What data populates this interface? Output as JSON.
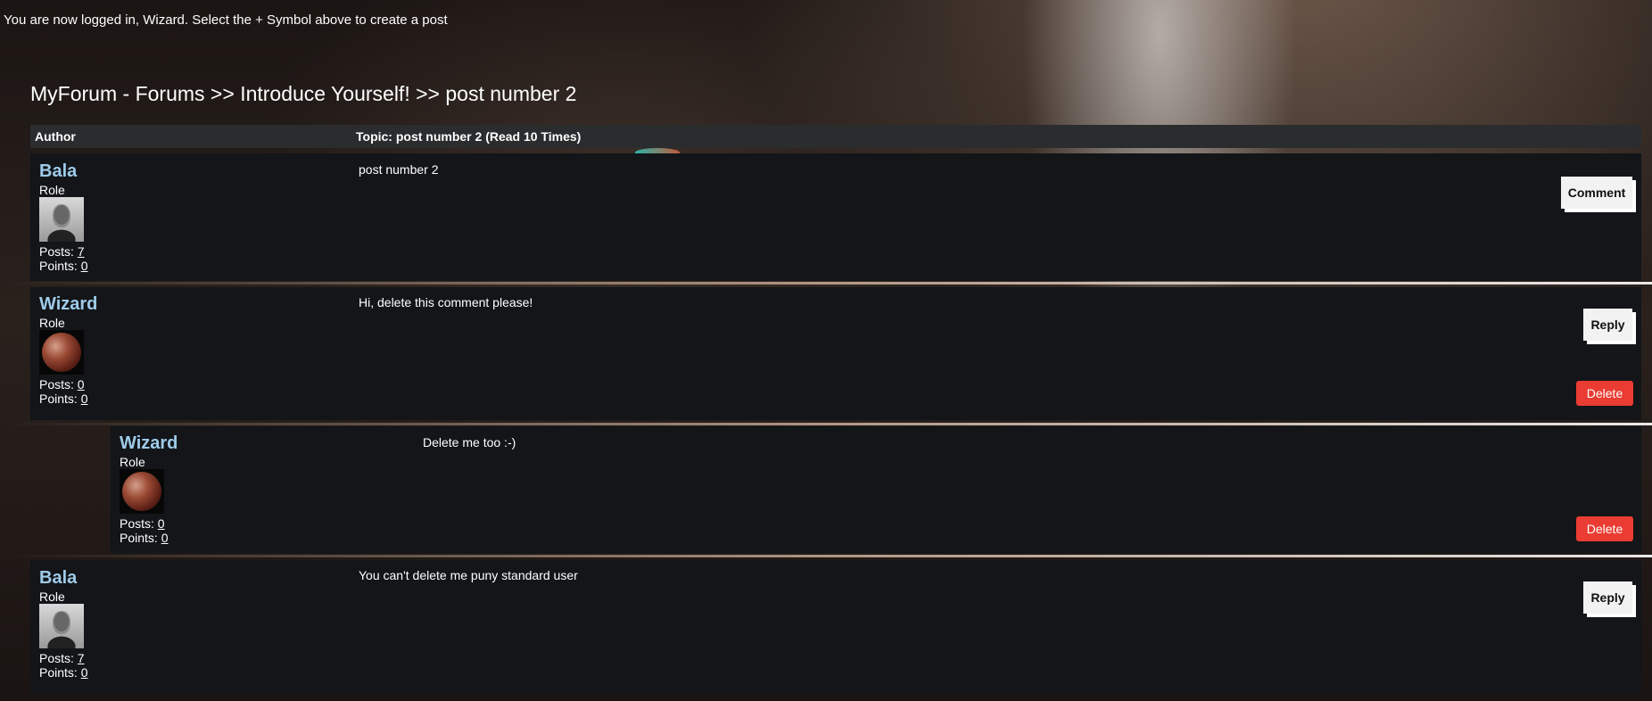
{
  "status": {
    "login_message": "You are now logged in, Wizard. Select the + Symbol above to create a post"
  },
  "breadcrumb": {
    "site": "MyForum",
    "separator1": " - ",
    "forums": "Forums",
    "separator2": " >> ",
    "category": "Introduce Yourself!",
    "separator3": " >> ",
    "topic": "post number 2"
  },
  "table_header": {
    "author": "Author",
    "topic": "Topic: post number 2 (Read 10 Times)"
  },
  "posts": [
    {
      "name": "Bala",
      "role": "Role",
      "avatar": "portrait-avatar",
      "posts_label": "Posts: ",
      "posts": "7",
      "points_label": "Points: ",
      "points": "0",
      "text": "post number 2",
      "action": "Comment"
    },
    {
      "name": "Wizard",
      "role": "Role",
      "avatar": "planet-avatar",
      "posts_label": "Posts: ",
      "posts": "0",
      "points_label": "Points: ",
      "points": "0",
      "text": "Hi, delete this comment please!",
      "action": "Reply",
      "delete": "Delete"
    },
    {
      "name": "Wizard",
      "role": "Role",
      "avatar": "planet-avatar",
      "posts_label": "Posts: ",
      "posts": "0",
      "points_label": "Points: ",
      "points": "0",
      "text": "Delete me too :-)",
      "delete": "Delete"
    },
    {
      "name": "Bala",
      "role": "Role",
      "avatar": "portrait-avatar",
      "posts_label": "Posts: ",
      "posts": "7",
      "points_label": "Points: ",
      "points": "0",
      "text": "You can't delete me puny standard user",
      "action": "Reply"
    }
  ],
  "colors": {
    "panel": "#131518",
    "header": "#2b2c2e",
    "username": "#9ecbea",
    "delete": "#ea3c32"
  }
}
